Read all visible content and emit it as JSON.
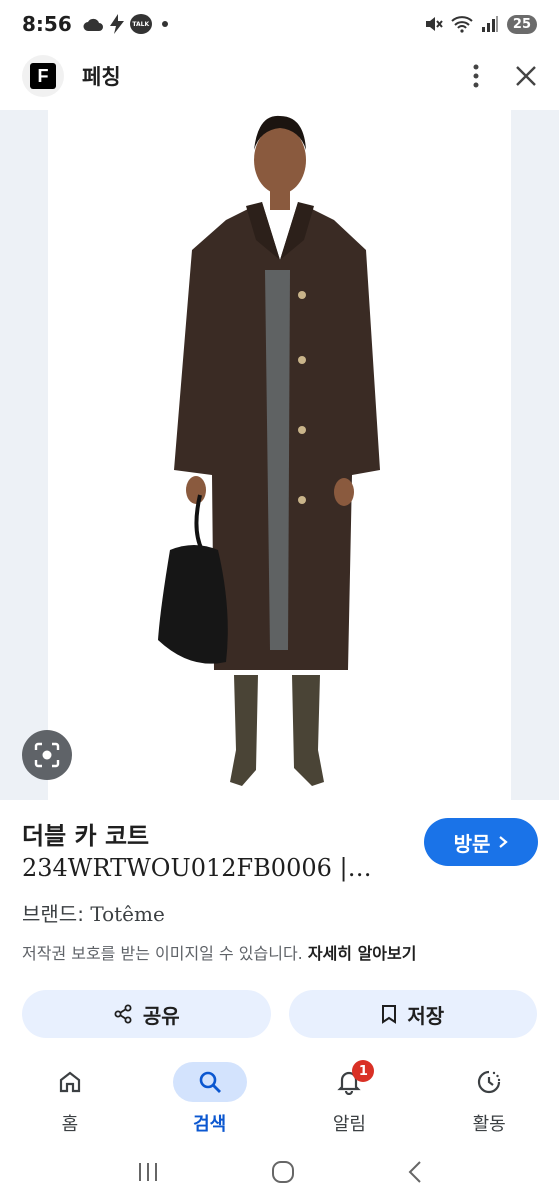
{
  "status_bar": {
    "time": "8:56",
    "talk_label": "TALK",
    "battery_level": "25"
  },
  "header": {
    "logo_letter": "F",
    "title": "페칭"
  },
  "product": {
    "title": "더블 카 코트",
    "subtitle": "234WRTWOU012FB0006 |…",
    "brand_label": "브랜드:",
    "brand_name": "Totême",
    "copyright_text": "저작권 보호를 받는 이미지일 수 있습니다.",
    "learn_more": "자세히 알아보기",
    "visit_label": "방문"
  },
  "actions": {
    "share_label": "공유",
    "save_label": "저장"
  },
  "bottom_nav": {
    "home": "홈",
    "search": "검색",
    "alerts": "알림",
    "alerts_badge": "1",
    "activity": "활동"
  },
  "colors": {
    "accent": "#1a73e8",
    "pill_bg": "#e8f0fe",
    "active_nav_bg": "#d3e3fd",
    "badge": "#d93025",
    "coat": "#3a2b24"
  }
}
